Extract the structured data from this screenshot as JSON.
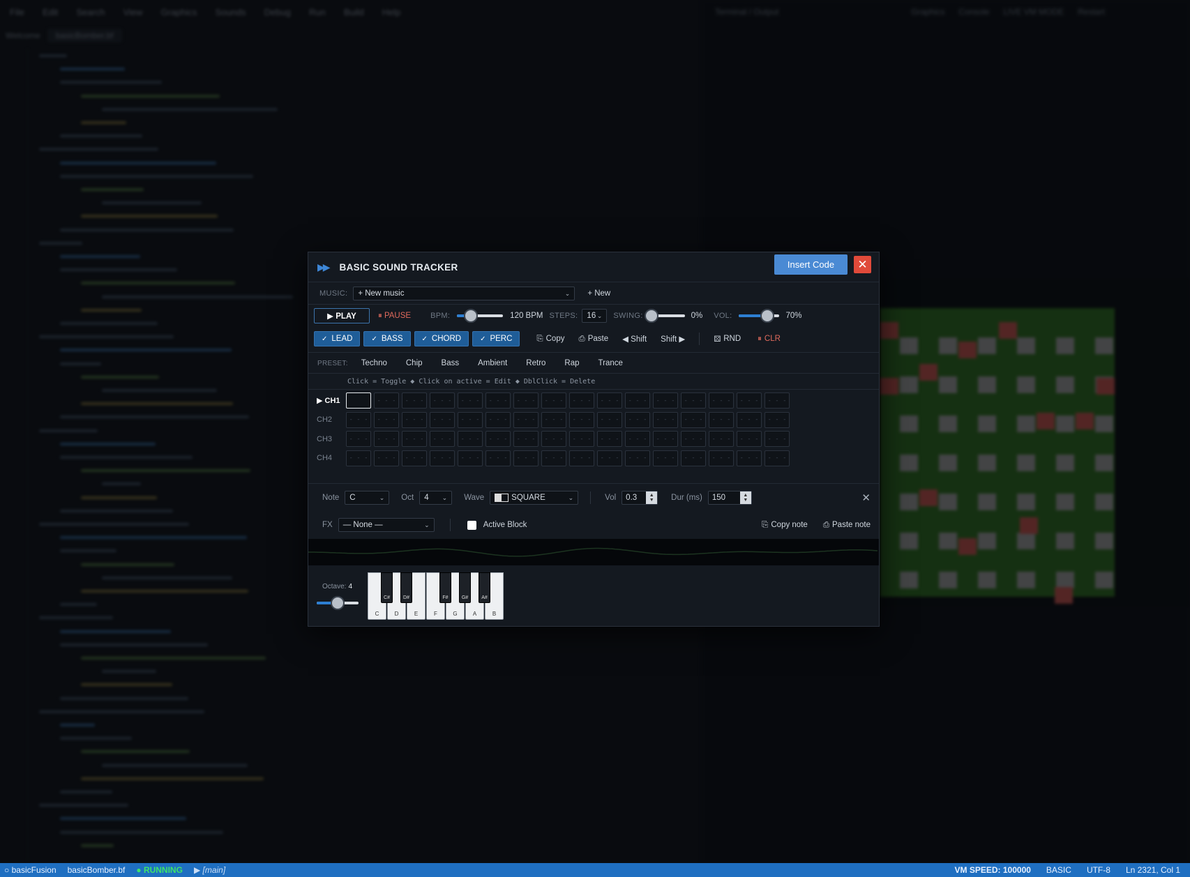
{
  "ide": {
    "menu": [
      "File",
      "Edit",
      "Search",
      "View",
      "Graphics",
      "Sounds",
      "Debug",
      "Run",
      "Build",
      "Help"
    ],
    "tabs": [
      "Welcome",
      "basicBomber.bf"
    ],
    "right_header": [
      "Terminal / Output",
      "Graphics",
      "Console",
      "LIVE VM MODE",
      "Restart"
    ]
  },
  "status_bar": {
    "project": "basicFusion",
    "file": "basicBomber.bf",
    "state": "RUNNING",
    "scope": "[main]",
    "vm_speed": "VM SPEED: 100000",
    "language": "BASIC",
    "encoding": "UTF-8",
    "position": "Ln 2321, Col 1"
  },
  "tracker": {
    "title": "BASIC SOUND TRACKER",
    "insert_label": "Insert Code",
    "close_glyph": "✕",
    "music_label": "MUSIC:",
    "music_value": "+ New music",
    "new_label": "+ New",
    "play_label": "▶ PLAY",
    "pause_label": "⏸ PAUSE",
    "bpm_label": "BPM:",
    "bpm_value": "120 BPM",
    "bpm_level": 0.3,
    "steps_label": "STEPS:",
    "steps_value": "16",
    "swing_label": "SWING:",
    "swing_value": "0%",
    "swing_level": 0.0,
    "vol_label": "VOL:",
    "vol_value": "70%",
    "vol_level": 0.7,
    "channels_toggles": [
      "LEAD",
      "BASS",
      "CHORD",
      "PERC"
    ],
    "copy_label": "Copy",
    "paste_label": "Paste",
    "shift_left_label": "◀ Shift",
    "shift_right_label": "Shift ▶",
    "rnd_label": "RND",
    "clr_label": "CLR",
    "preset_label": "PRESET:",
    "presets": [
      "Techno",
      "Chip",
      "Bass",
      "Ambient",
      "Retro",
      "Rap",
      "Trance"
    ],
    "hint": "Click = Toggle ◆ Click on active = Edit ◆ DblClick = Delete",
    "channels": [
      "▶ CH1",
      "CH2",
      "CH3",
      "CH4"
    ],
    "steps_count": 16,
    "empty_cell": "- - -",
    "note_label": "Note",
    "note_value": "C",
    "oct_label": "Oct",
    "oct_value": "4",
    "wave_label": "Wave",
    "wave_value": "SQUARE",
    "vol_field_label": "Vol",
    "vol_field_value": "0.3",
    "dur_label": "Dur (ms)",
    "dur_value": "150",
    "fx_label": "FX",
    "fx_value": "— None —",
    "active_block_label": "Active Block",
    "copy_note_label": "Copy note",
    "paste_note_label": "Paste note",
    "octave_label": "Octave:",
    "octave_value": "4",
    "octave_level": 0.5,
    "white_keys": [
      "C",
      "D",
      "E",
      "F",
      "G",
      "A",
      "B"
    ],
    "black_keys": [
      "C#",
      "D#",
      "F#",
      "G#",
      "A#"
    ]
  },
  "colors": {
    "accent": "#2d7fd3",
    "insert_button": "#4a8ad4",
    "close_button": "#e04a3a",
    "status_bar": "#1f6fc1",
    "running": "#3ee26b"
  }
}
